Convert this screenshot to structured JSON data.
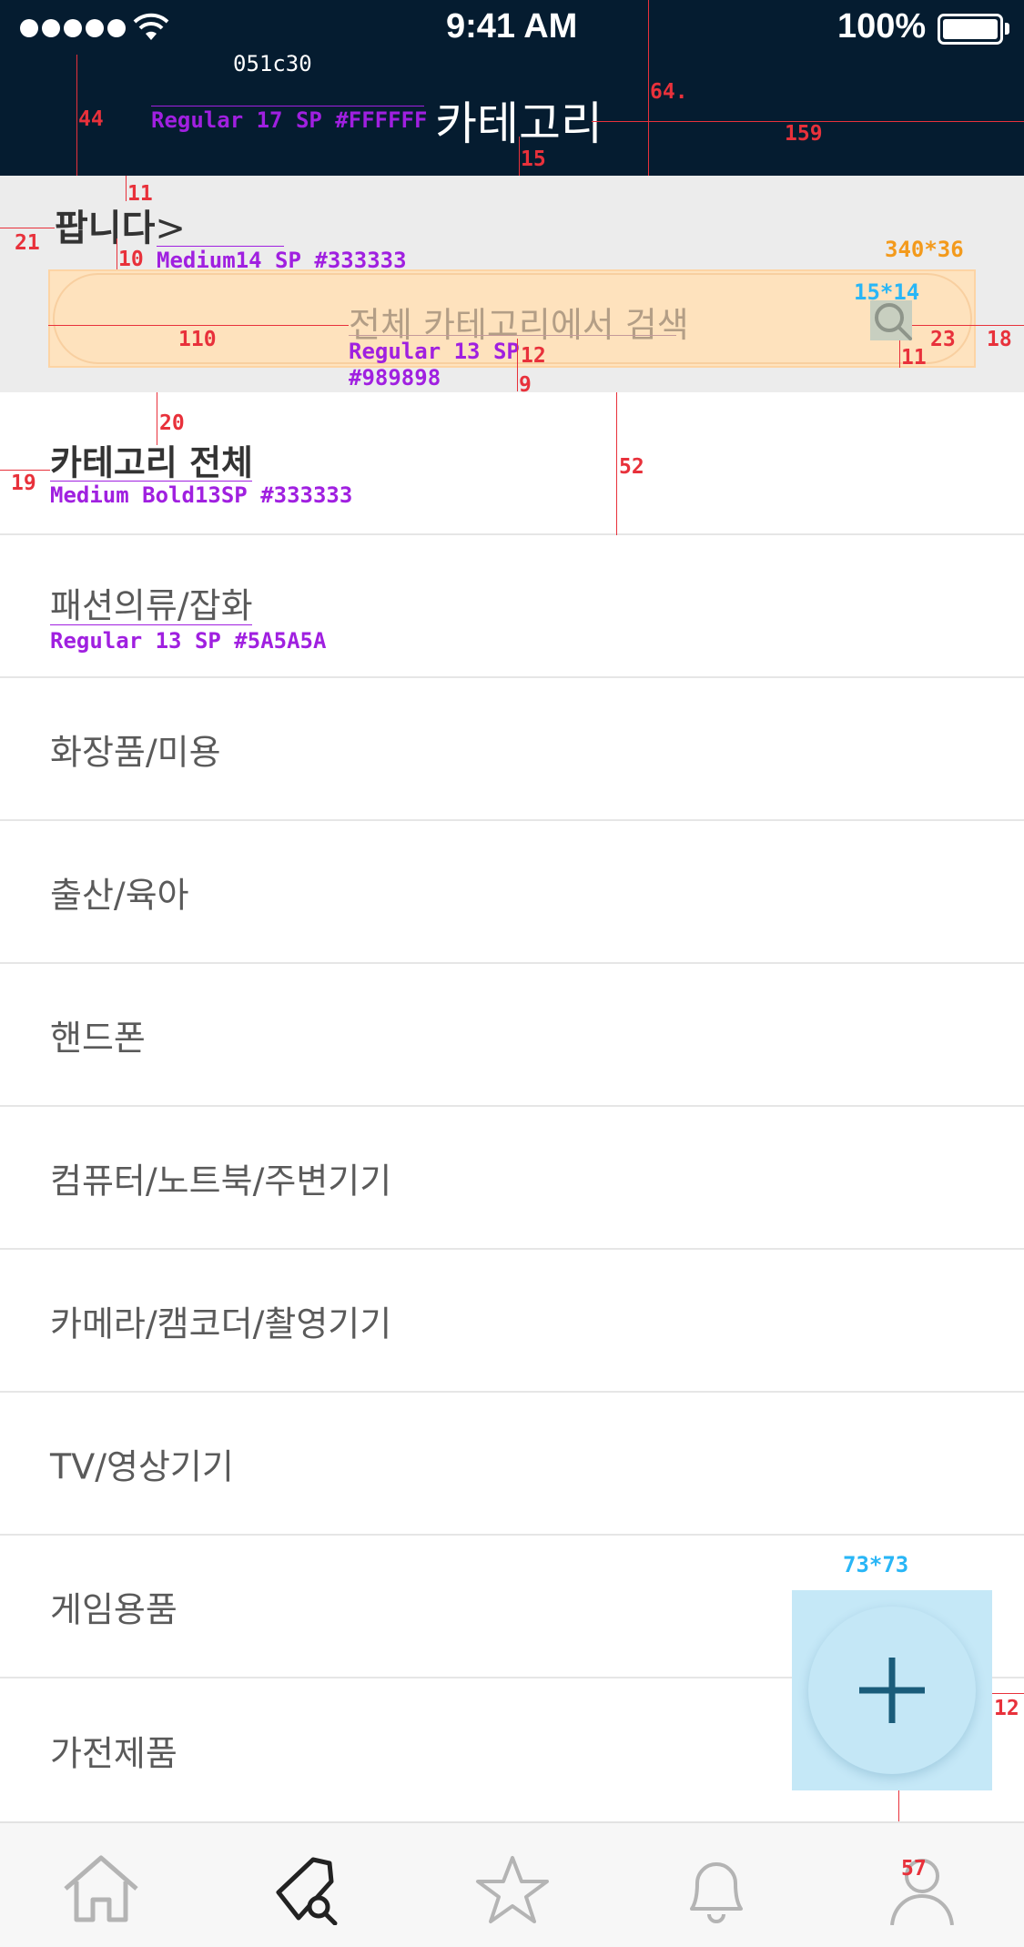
{
  "status_bar": {
    "time": "9:41 AM",
    "battery": "100%",
    "signal_dots": 5
  },
  "nav": {
    "title": "카테고리",
    "spec_color": "051c30"
  },
  "seller": {
    "title": "팝니다",
    "chevron": ">"
  },
  "search": {
    "placeholder": "전체 카테고리에서 검색",
    "icon": "search-icon"
  },
  "categories": {
    "all": "카테고리 전체",
    "items": [
      "패션의류/잡화",
      "화장품/미용",
      "출산/육아",
      "핸드폰",
      "컴퓨터/노트북/주변기기",
      "카메라/캠코더/촬영기기",
      "TV/영상기기",
      "게임용품",
      "가전제품"
    ]
  },
  "fab": {
    "icon": "plus-icon",
    "spec": "73*73"
  },
  "tabbar": {
    "icons": [
      "home-icon",
      "tag-search-icon",
      "star-icon",
      "bell-icon",
      "user-icon"
    ]
  },
  "annotations": {
    "nav_font": "Regular 17 SP #FFFFFF",
    "seller_font": "Medium14 SP #333333",
    "search_size": "340*36",
    "icon_size": "15*14",
    "search_font_1": "Regular 13 SP",
    "search_font_2": "#989898",
    "all_font": "Medium Bold13SP #333333",
    "item_font": "Regular 13 SP #5A5A5A",
    "dims": {
      "d44": "44",
      "d64": "64.",
      "d159": "159",
      "d15": "15",
      "d11a": "11",
      "d21": "21",
      "d10": "10",
      "d110": "110",
      "d12": "12",
      "d9": "9",
      "d23": "23",
      "d18": "18",
      "d11b": "11",
      "d20": "20",
      "d19": "19",
      "d52": "52",
      "d12b": "12",
      "d57": "57"
    }
  },
  "colors": {
    "nav_bg": "#051c30",
    "seller_bg": "#ececec",
    "text_dark": "#333333",
    "text_item": "#5a5a5a",
    "placeholder": "#989898",
    "fab_highlight": "#c5e8f7",
    "fab_icon": "#1a5c7a"
  }
}
